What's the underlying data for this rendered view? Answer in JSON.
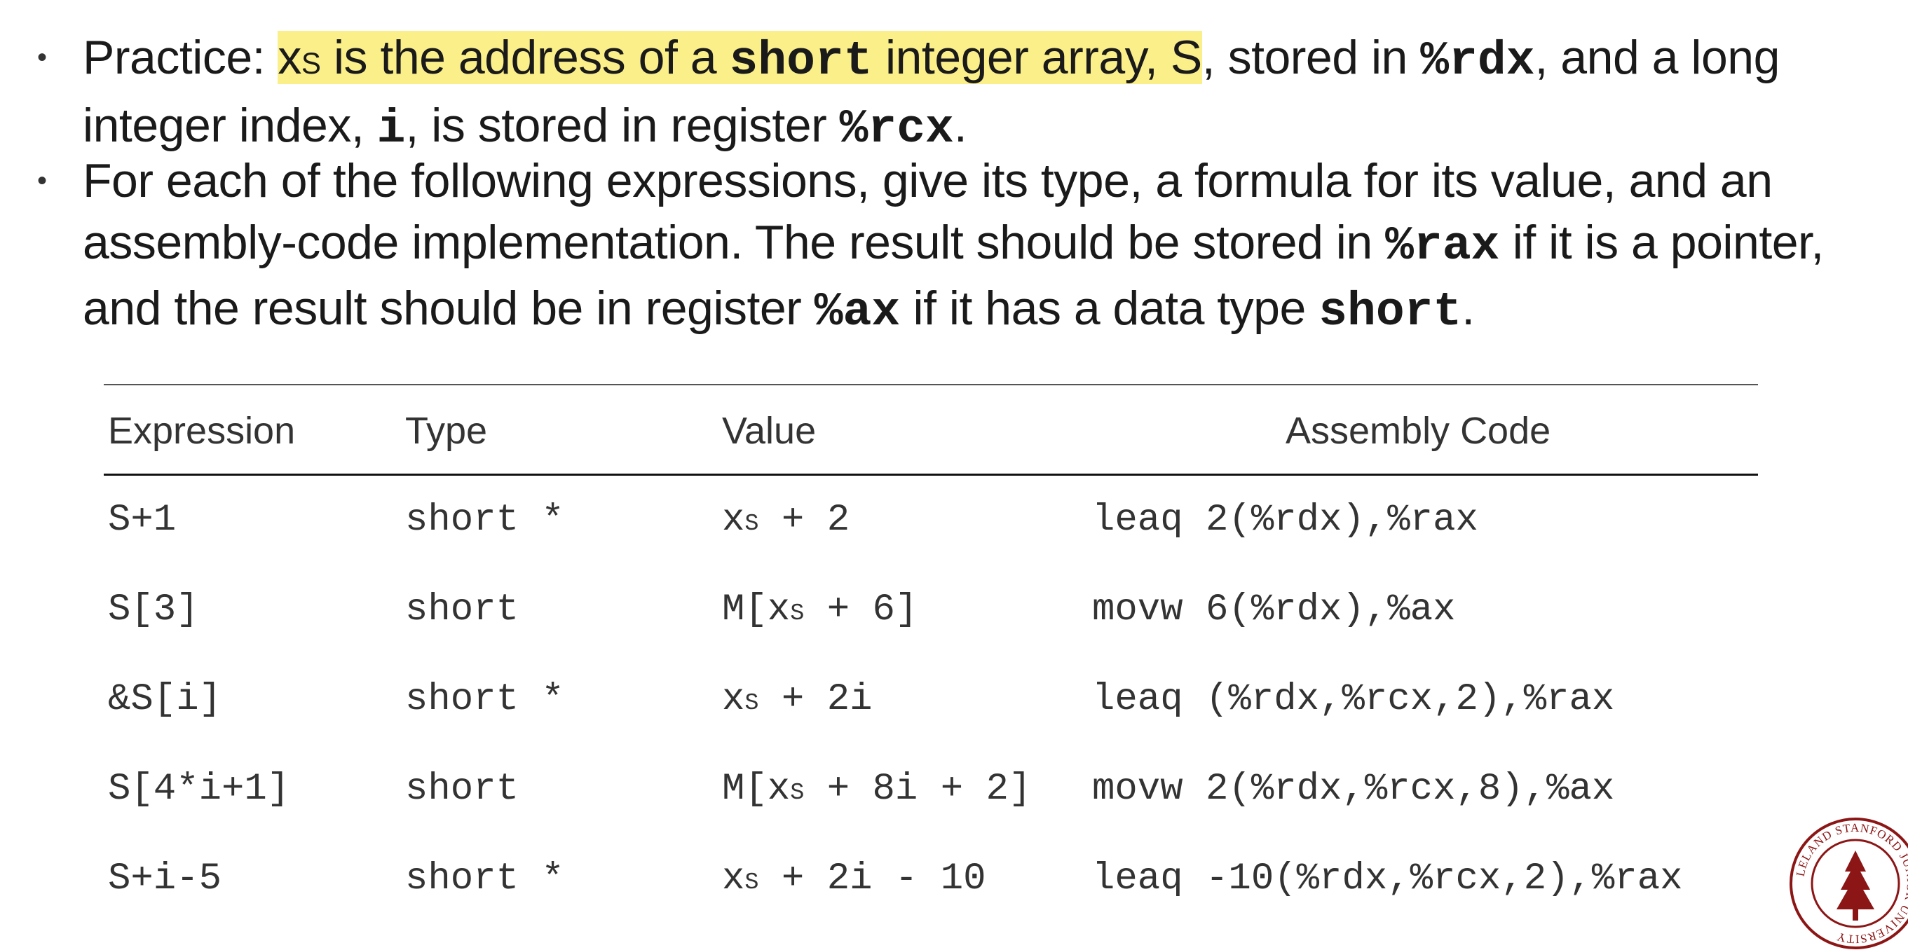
{
  "bullets": {
    "b1": {
      "prefix": "Practice: ",
      "hl_x": "x",
      "hl_sub": "S",
      "hl_text1": " is the address of a ",
      "hl_code": "short",
      "hl_text2": " integer array, S",
      "text3": ", stored in ",
      "code1": "%rdx",
      "text4": ", and a long integer index, ",
      "code2": "i",
      "text5": ", is stored in register ",
      "code3": "%rcx",
      "text6": "."
    },
    "b2": {
      "text1": "For each of the following expressions, give its type, a formula for its value, and an assembly-code implementation. The result should be stored in ",
      "code1": "%rax",
      "text2": " if it is a pointer, and the result should be in register ",
      "code2": "%ax",
      "text3": " if it has a data type ",
      "code3": "short",
      "text4": "."
    }
  },
  "table": {
    "headers": [
      "Expression",
      "Type",
      "Value",
      "Assembly Code"
    ],
    "rows": [
      {
        "expr": "S+1",
        "type": "short *",
        "value_pre": "x",
        "value_sub": "S",
        "value_post": " + 2",
        "asm": "leaq 2(%rdx),%rax"
      },
      {
        "expr": "S[3]",
        "type": "short",
        "value_pre": "M[x",
        "value_sub": "S",
        "value_post": " + 6]",
        "asm": "movw 6(%rdx),%ax"
      },
      {
        "expr": "&S[i]",
        "type": "short *",
        "value_pre": "x",
        "value_sub": "S",
        "value_post": " + 2i",
        "asm": "leaq (%rdx,%rcx,2),%rax"
      },
      {
        "expr": "S[4*i+1]",
        "type": "short",
        "value_pre": "M[x",
        "value_sub": "S",
        "value_post": " + 8i + 2]",
        "asm": "movw 2(%rdx,%rcx,8),%ax"
      },
      {
        "expr": "S+i-5",
        "type": "short *",
        "value_pre": "x",
        "value_sub": "S",
        "value_post": " + 2i - 10",
        "asm": "leaq -10(%rdx,%rcx,2),%rax"
      }
    ]
  },
  "logo": {
    "icon": "university-seal-icon",
    "text": "LELAND STANFORD JUNIOR UNIVERSITY"
  },
  "colors": {
    "highlight": "#fbef8a",
    "text": "#1a1a1a",
    "seal": "#8c1515"
  }
}
